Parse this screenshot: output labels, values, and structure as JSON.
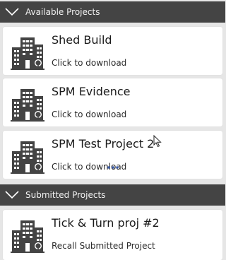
{
  "sections": [
    {
      "title": "Available Projects",
      "chevron_icon": "chevron-down-icon",
      "items": [
        {
          "name": "Shed Build",
          "action": "Click to download",
          "icon": "building-icon"
        },
        {
          "name": "SPM Evidence",
          "action": "Click to download",
          "icon": "building-icon"
        },
        {
          "name": "SPM Test Project 2",
          "action": "Click to download",
          "icon": "building-icon"
        }
      ]
    },
    {
      "title": "Submitted Projects",
      "chevron_icon": "chevron-down-icon",
      "items": [
        {
          "name": "Tick & Turn proj #2",
          "action": "Recall Submitted Project",
          "icon": "building-icon"
        }
      ]
    }
  ],
  "colors": {
    "header_bg": "#444444",
    "header_text": "#f2f2f2",
    "page_bg": "#e6e6e6",
    "card_bg": "#ffffff",
    "icon_color": "#444444",
    "busy_indicator": "#3b5ba5"
  },
  "pointer": {
    "icon": "mouse-pointer-icon"
  },
  "busy_indicator": {
    "icon": "loading-dots-icon"
  }
}
